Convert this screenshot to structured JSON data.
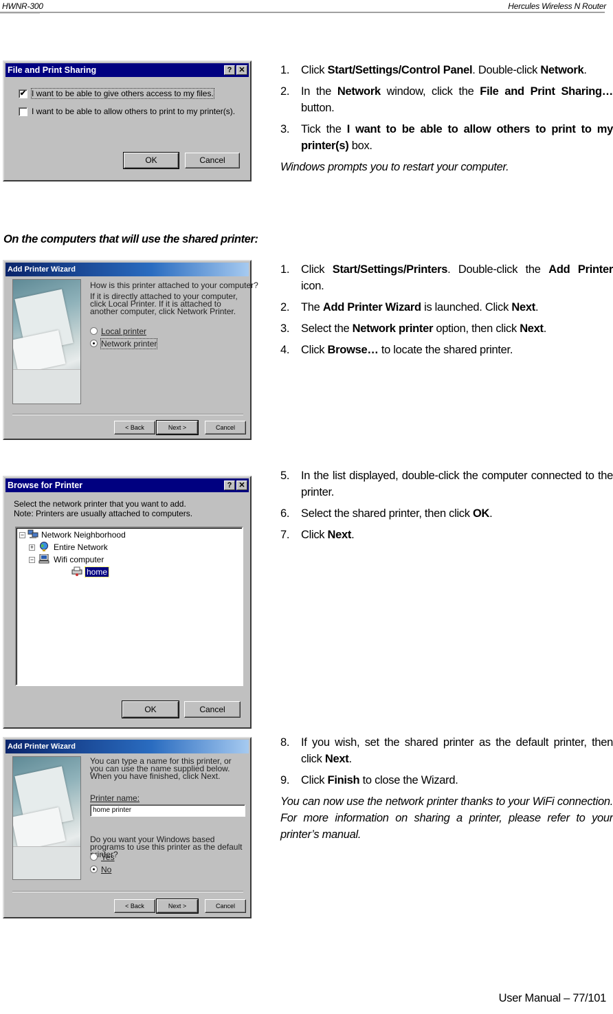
{
  "header": {
    "model": "HWNR-300",
    "product": "Hercules Wireless N Router"
  },
  "section1": {
    "dialog": {
      "title": "File and Print Sharing",
      "help_btn": "?",
      "close_btn": "✕",
      "options": [
        {
          "label": "I want to be able to give others access to my files.",
          "checked": true
        },
        {
          "label": "I want to be able to allow others to print to my printer(s).",
          "checked": false
        }
      ],
      "ok": "OK",
      "cancel": "Cancel"
    },
    "steps": [
      {
        "num": "1.",
        "parts": [
          [
            "",
            "Click "
          ],
          [
            "b",
            "Start/Settings/Control Panel"
          ],
          [
            "",
            ".  Double-click "
          ],
          [
            "b",
            "Network"
          ],
          [
            "",
            "."
          ]
        ]
      },
      {
        "num": "2.",
        "parts": [
          [
            "",
            "In the "
          ],
          [
            "b",
            "Network"
          ],
          [
            "",
            " window, click the "
          ],
          [
            "b",
            "File and Print Sharing…"
          ],
          [
            "",
            " button."
          ]
        ]
      },
      {
        "num": "3.",
        "parts": [
          [
            "",
            "Tick the "
          ],
          [
            "b",
            "I want to be able to allow others to print to my printer(s)"
          ],
          [
            "",
            " box."
          ]
        ]
      }
    ],
    "note": "Windows prompts you to restart your computer."
  },
  "section_heading": "On the computers that will use the shared printer:",
  "section2": {
    "dialog": {
      "title": "Add Printer Wizard",
      "question": "How is this printer attached to your computer?",
      "description": "If it is directly attached to your computer, click Local Printer. If it is attached to another computer, click Network Printer.",
      "options": [
        {
          "label": "Local printer",
          "selected": false
        },
        {
          "label": "Network printer",
          "selected": true
        }
      ],
      "back": "< Back",
      "next": "Next >",
      "cancel": "Cancel"
    },
    "steps": [
      {
        "num": "1.",
        "parts": [
          [
            "",
            "Click "
          ],
          [
            "b",
            "Start/Settings/Printers"
          ],
          [
            "",
            ".  Double-click the "
          ],
          [
            "b",
            "Add Printer"
          ],
          [
            "",
            " icon."
          ]
        ]
      },
      {
        "num": "2.",
        "parts": [
          [
            "",
            "The "
          ],
          [
            "b",
            "Add Printer Wizard"
          ],
          [
            "",
            " is launched.  Click "
          ],
          [
            "b",
            "Next"
          ],
          [
            "",
            "."
          ]
        ]
      },
      {
        "num": "3.",
        "parts": [
          [
            "",
            "Select the "
          ],
          [
            "b",
            "Network printer"
          ],
          [
            "",
            " option, then click "
          ],
          [
            "b",
            "Next"
          ],
          [
            "",
            "."
          ]
        ]
      },
      {
        "num": "4.",
        "parts": [
          [
            "",
            "Click "
          ],
          [
            "b",
            "Browse…"
          ],
          [
            "",
            " to locate the shared printer."
          ]
        ]
      }
    ]
  },
  "section3": {
    "dialog": {
      "title": "Browse for Printer",
      "help_btn": "?",
      "close_btn": "✕",
      "instruction1": "Select the network printer that you want to add.",
      "instruction2": "Note: Printers are usually attached to computers.",
      "tree": [
        {
          "label": "Network Neighborhood",
          "expander": "−",
          "icon": "network-neighborhood-icon"
        },
        {
          "label": "Entire Network",
          "expander": "+",
          "icon": "globe-icon"
        },
        {
          "label": "Wifi computer",
          "expander": "−",
          "icon": "computer-icon"
        },
        {
          "label": "home",
          "expander": "",
          "icon": "shared-printer-icon",
          "selected": true
        }
      ],
      "ok": "OK",
      "cancel": "Cancel"
    },
    "steps": [
      {
        "num": "5.",
        "parts": [
          [
            "",
            "In the list displayed, double-click the computer connected to the printer."
          ]
        ]
      },
      {
        "num": "6.",
        "parts": [
          [
            "",
            "Select the shared printer, then click "
          ],
          [
            "b",
            "OK"
          ],
          [
            "",
            "."
          ]
        ]
      },
      {
        "num": "7.",
        "parts": [
          [
            "",
            "Click "
          ],
          [
            "b",
            "Next"
          ],
          [
            "",
            "."
          ]
        ]
      }
    ]
  },
  "section4": {
    "dialog": {
      "title": "Add Printer Wizard",
      "intro": "You can type a name for this printer, or you can use the name supplied below. When you have finished, click Next.",
      "name_label": "Printer name:",
      "name_value": "home printer",
      "default_question": "Do you want your Windows based programs to use this printer as the default printer?",
      "options": [
        {
          "label": "Yes",
          "selected": false
        },
        {
          "label": "No",
          "selected": true
        }
      ],
      "back": "< Back",
      "next": "Next >",
      "cancel": "Cancel"
    },
    "steps": [
      {
        "num": "8.",
        "parts": [
          [
            "",
            "If you wish, set the shared printer as the default printer, then click "
          ],
          [
            "b",
            "Next"
          ],
          [
            "",
            "."
          ]
        ]
      },
      {
        "num": "9.",
        "parts": [
          [
            "",
            "Click "
          ],
          [
            "b",
            "Finish"
          ],
          [
            "",
            " to close the Wizard."
          ]
        ]
      }
    ],
    "note": "You can now use the network printer thanks to your WiFi connection.  For more information on sharing a printer, please refer to your printer’s manual."
  },
  "footer": "User Manual – 77/101"
}
